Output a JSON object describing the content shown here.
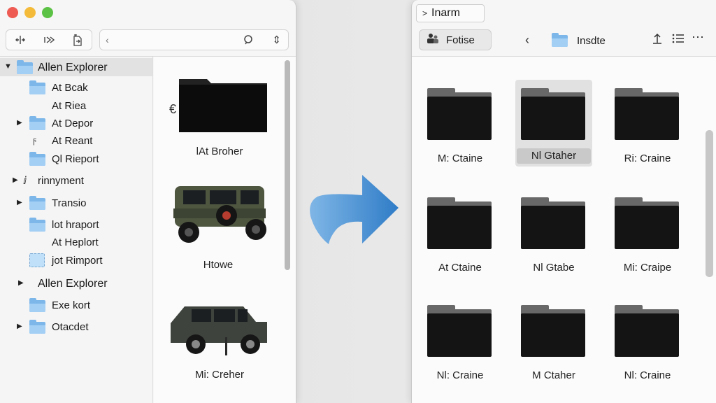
{
  "left_window": {
    "sidebar": {
      "items": [
        {
          "label": "Allen Explorer",
          "icon": "folder-icon",
          "expanded": true,
          "selected": true
        },
        {
          "label": "At Bcak",
          "icon": "folder-icon"
        },
        {
          "label": "At Riea",
          "icon": "none"
        },
        {
          "label": "At Depor",
          "icon": "folder-icon",
          "collapsed": true
        },
        {
          "label": "At Reant",
          "icon": "lightning-icon"
        },
        {
          "label": "Ql Rieport",
          "icon": "folder-icon"
        },
        {
          "label": "rinnyment",
          "icon": "cursor-icon",
          "collapsed": true
        },
        {
          "label": "Transio",
          "icon": "folder-icon",
          "collapsed": true
        },
        {
          "label": "lot hraport",
          "icon": "folder-icon"
        },
        {
          "label": "At Heplort",
          "icon": "none"
        },
        {
          "label": "jot Rimport",
          "icon": "image-icon"
        },
        {
          "label": "Allen Explorer",
          "icon": "none",
          "collapsed": true
        },
        {
          "label": "Exe kort",
          "icon": "folder-icon"
        },
        {
          "label": "Otacdet",
          "icon": "folder-icon",
          "collapsed": true
        }
      ]
    },
    "preview": {
      "items": [
        {
          "label": "lAt Broher",
          "kind": "black-folder"
        },
        {
          "label": "Htowe",
          "kind": "jeep-image"
        },
        {
          "label": "Mi: Creher",
          "kind": "suv-image"
        }
      ]
    }
  },
  "right_window": {
    "title": "Inarm",
    "view_button": "Fotise",
    "path": "Insdte",
    "grid": [
      {
        "label": "M: Ctaine"
      },
      {
        "label": "Nl Gtaher",
        "selected": true
      },
      {
        "label": "Ri: Craine"
      },
      {
        "label": "At Ctaine"
      },
      {
        "label": "Nl Gtabe"
      },
      {
        "label": "Mi: Craipe"
      },
      {
        "label": "Nl: Craine"
      },
      {
        "label": "M Ctaher"
      },
      {
        "label": "Nl: Craine"
      }
    ]
  },
  "colors": {
    "folder_blue": "#7db7ea",
    "arrow_blue": "#4a94d6",
    "traffic_red": "#ee5b52",
    "traffic_yellow": "#f4bb3a",
    "traffic_green": "#5cc245"
  }
}
